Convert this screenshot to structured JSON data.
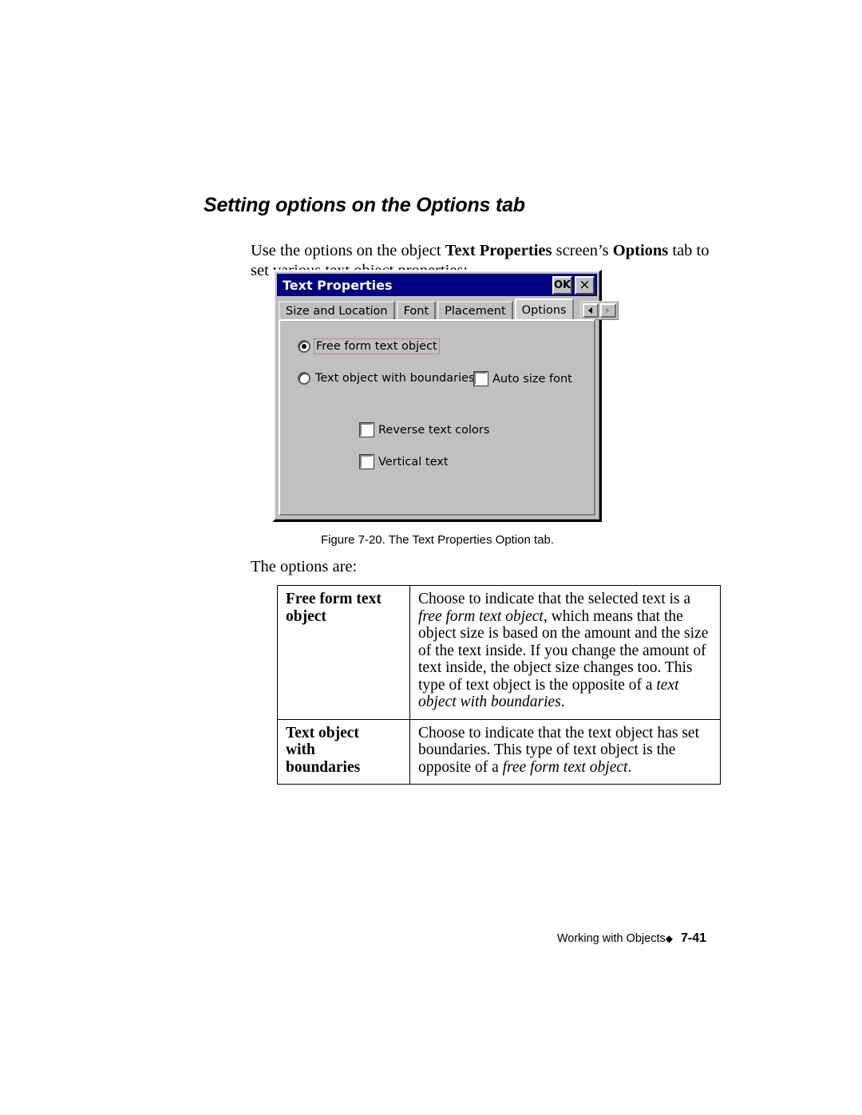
{
  "page": {
    "heading": "Setting options on the Options tab",
    "intro_before_bold1": "Use the options on the object ",
    "intro_bold1": "Text Properties",
    "intro_middle": " screen’s ",
    "intro_bold2": "Options",
    "intro_after": " tab to set various text object properties:",
    "figure_caption": "Figure 7-20. The Text Properties Option tab.",
    "options_lead": "The options are:"
  },
  "dialog": {
    "title": "Text Properties",
    "ok_label": "OK",
    "close_label": "×",
    "tabs": [
      {
        "label": "Size and Location",
        "active": false
      },
      {
        "label": "Font",
        "active": false
      },
      {
        "label": "Placement",
        "active": false
      },
      {
        "label": "Options",
        "active": true
      }
    ],
    "tab_nav": {
      "prev_label": "◄",
      "next_label": "►"
    },
    "controls": {
      "radio_free_form": {
        "label": "Free form text object",
        "checked": true,
        "focused": true
      },
      "radio_with_boundaries": {
        "label": "Text object with boundaries",
        "checked": false,
        "focused": false
      },
      "checkbox_auto_size_font": {
        "label": "Auto size font",
        "checked": false
      },
      "checkbox_reverse_text_colors": {
        "label": "Reverse text colors",
        "checked": false
      },
      "checkbox_vertical_text": {
        "label": "Vertical text",
        "checked": false
      }
    }
  },
  "options_table": {
    "rows": [
      {
        "term": "Free form text object",
        "desc_part1": "Choose to indicate that the selected text is a ",
        "desc_em1": "free form text object",
        "desc_part2": ", which means that the object size is based on the amount and the size of the text inside. If you change the amount of text inside, the object size changes too. This type of text object is the opposite of a ",
        "desc_em2": "text object with boundaries",
        "desc_part3": "."
      },
      {
        "term": "Text object with boundaries",
        "desc_part1": "Choose to indicate that the text object has set boundaries. This type of text object is the opposite of a ",
        "desc_em1": "free form text object",
        "desc_part2": ".",
        "desc_em2": "",
        "desc_part3": ""
      }
    ]
  },
  "footer": {
    "section": "Working with Objects",
    "diamond": "◆",
    "page_number": "7-41"
  },
  "colors": {
    "titlebar": "#000080",
    "dialog_face": "#c0c0c0",
    "focus_outline": "#c03fa8",
    "text": "#000000"
  }
}
